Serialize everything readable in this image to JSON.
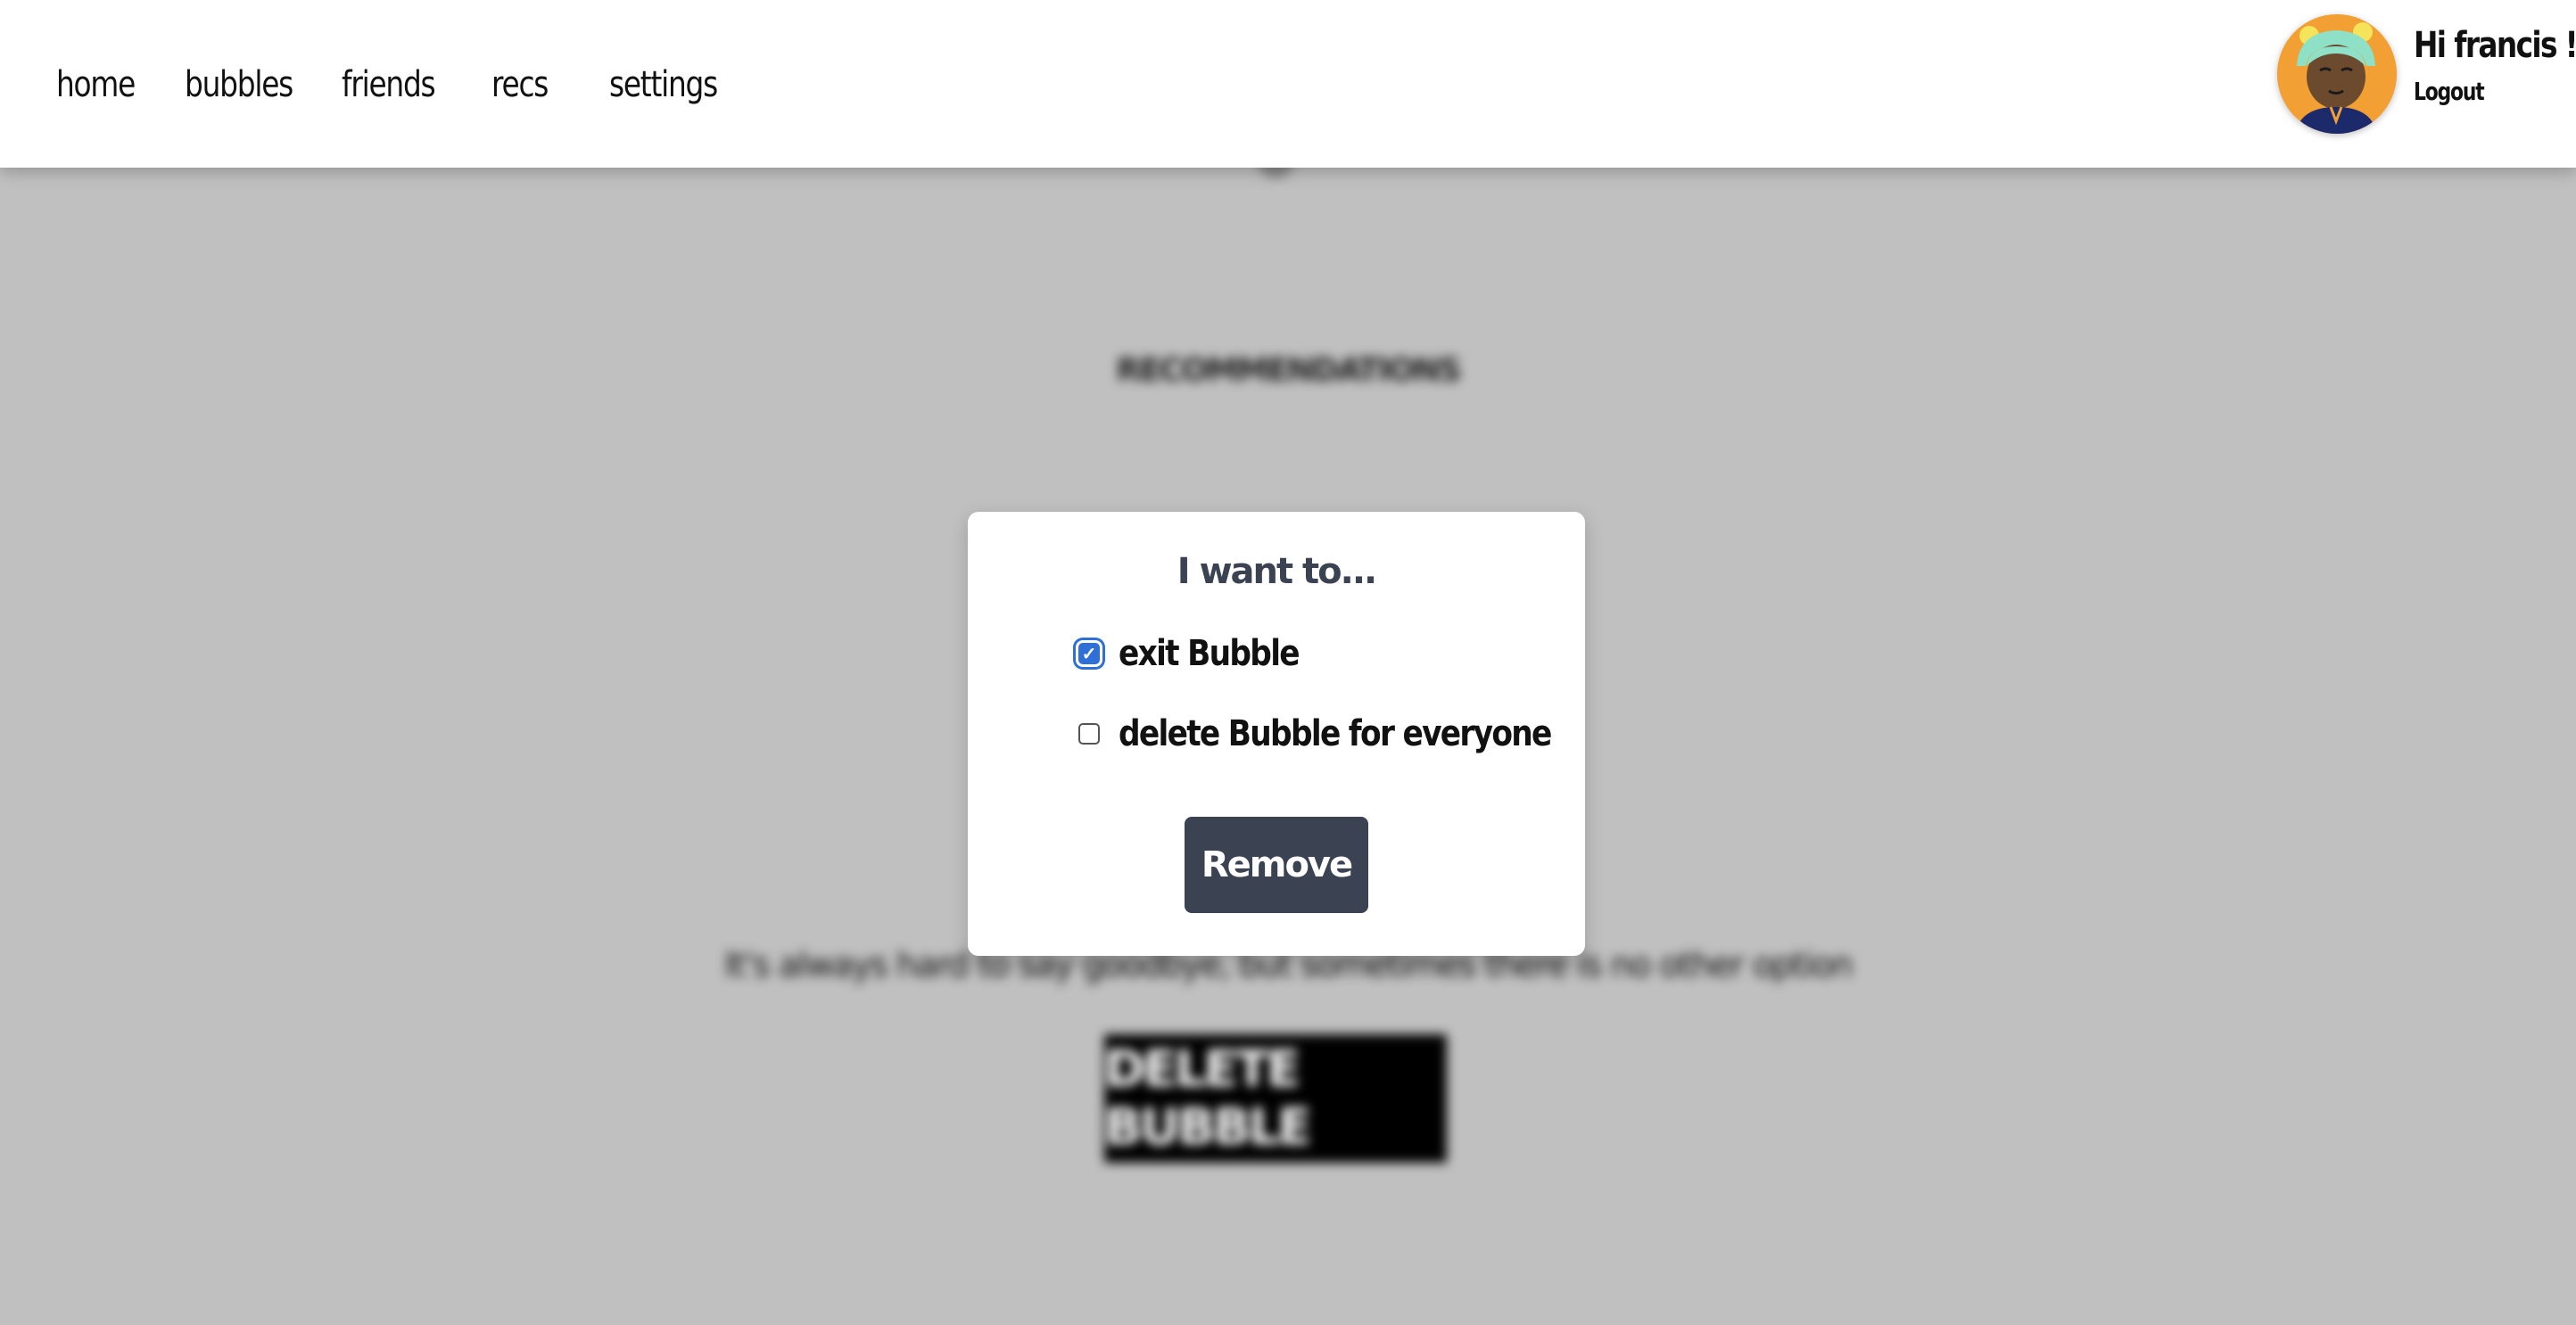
{
  "nav": {
    "items": [
      {
        "label": "home"
      },
      {
        "label": "bubbles"
      },
      {
        "label": "friends"
      },
      {
        "label": "recs"
      },
      {
        "label": "settings"
      }
    ]
  },
  "user": {
    "greeting": "Hi francis !",
    "logout_label": "Logout",
    "avatar_bg": "#f2a033"
  },
  "background_page": {
    "heading": "RECOMMENDATIONS",
    "goodbye_text": "It's always hard to say goodbye, but sometimes there is no other option",
    "delete_button_label": "DELETE BUBBLE"
  },
  "modal": {
    "title": "I want to...",
    "options": [
      {
        "label": "exit Bubble",
        "checked": true
      },
      {
        "label": "delete Bubble for everyone",
        "checked": false
      }
    ],
    "remove_label": "Remove"
  },
  "colors": {
    "overlay": "#c0c0c0",
    "primary_button": "#3b4251",
    "checkbox_accent": "#2f6fd8"
  }
}
